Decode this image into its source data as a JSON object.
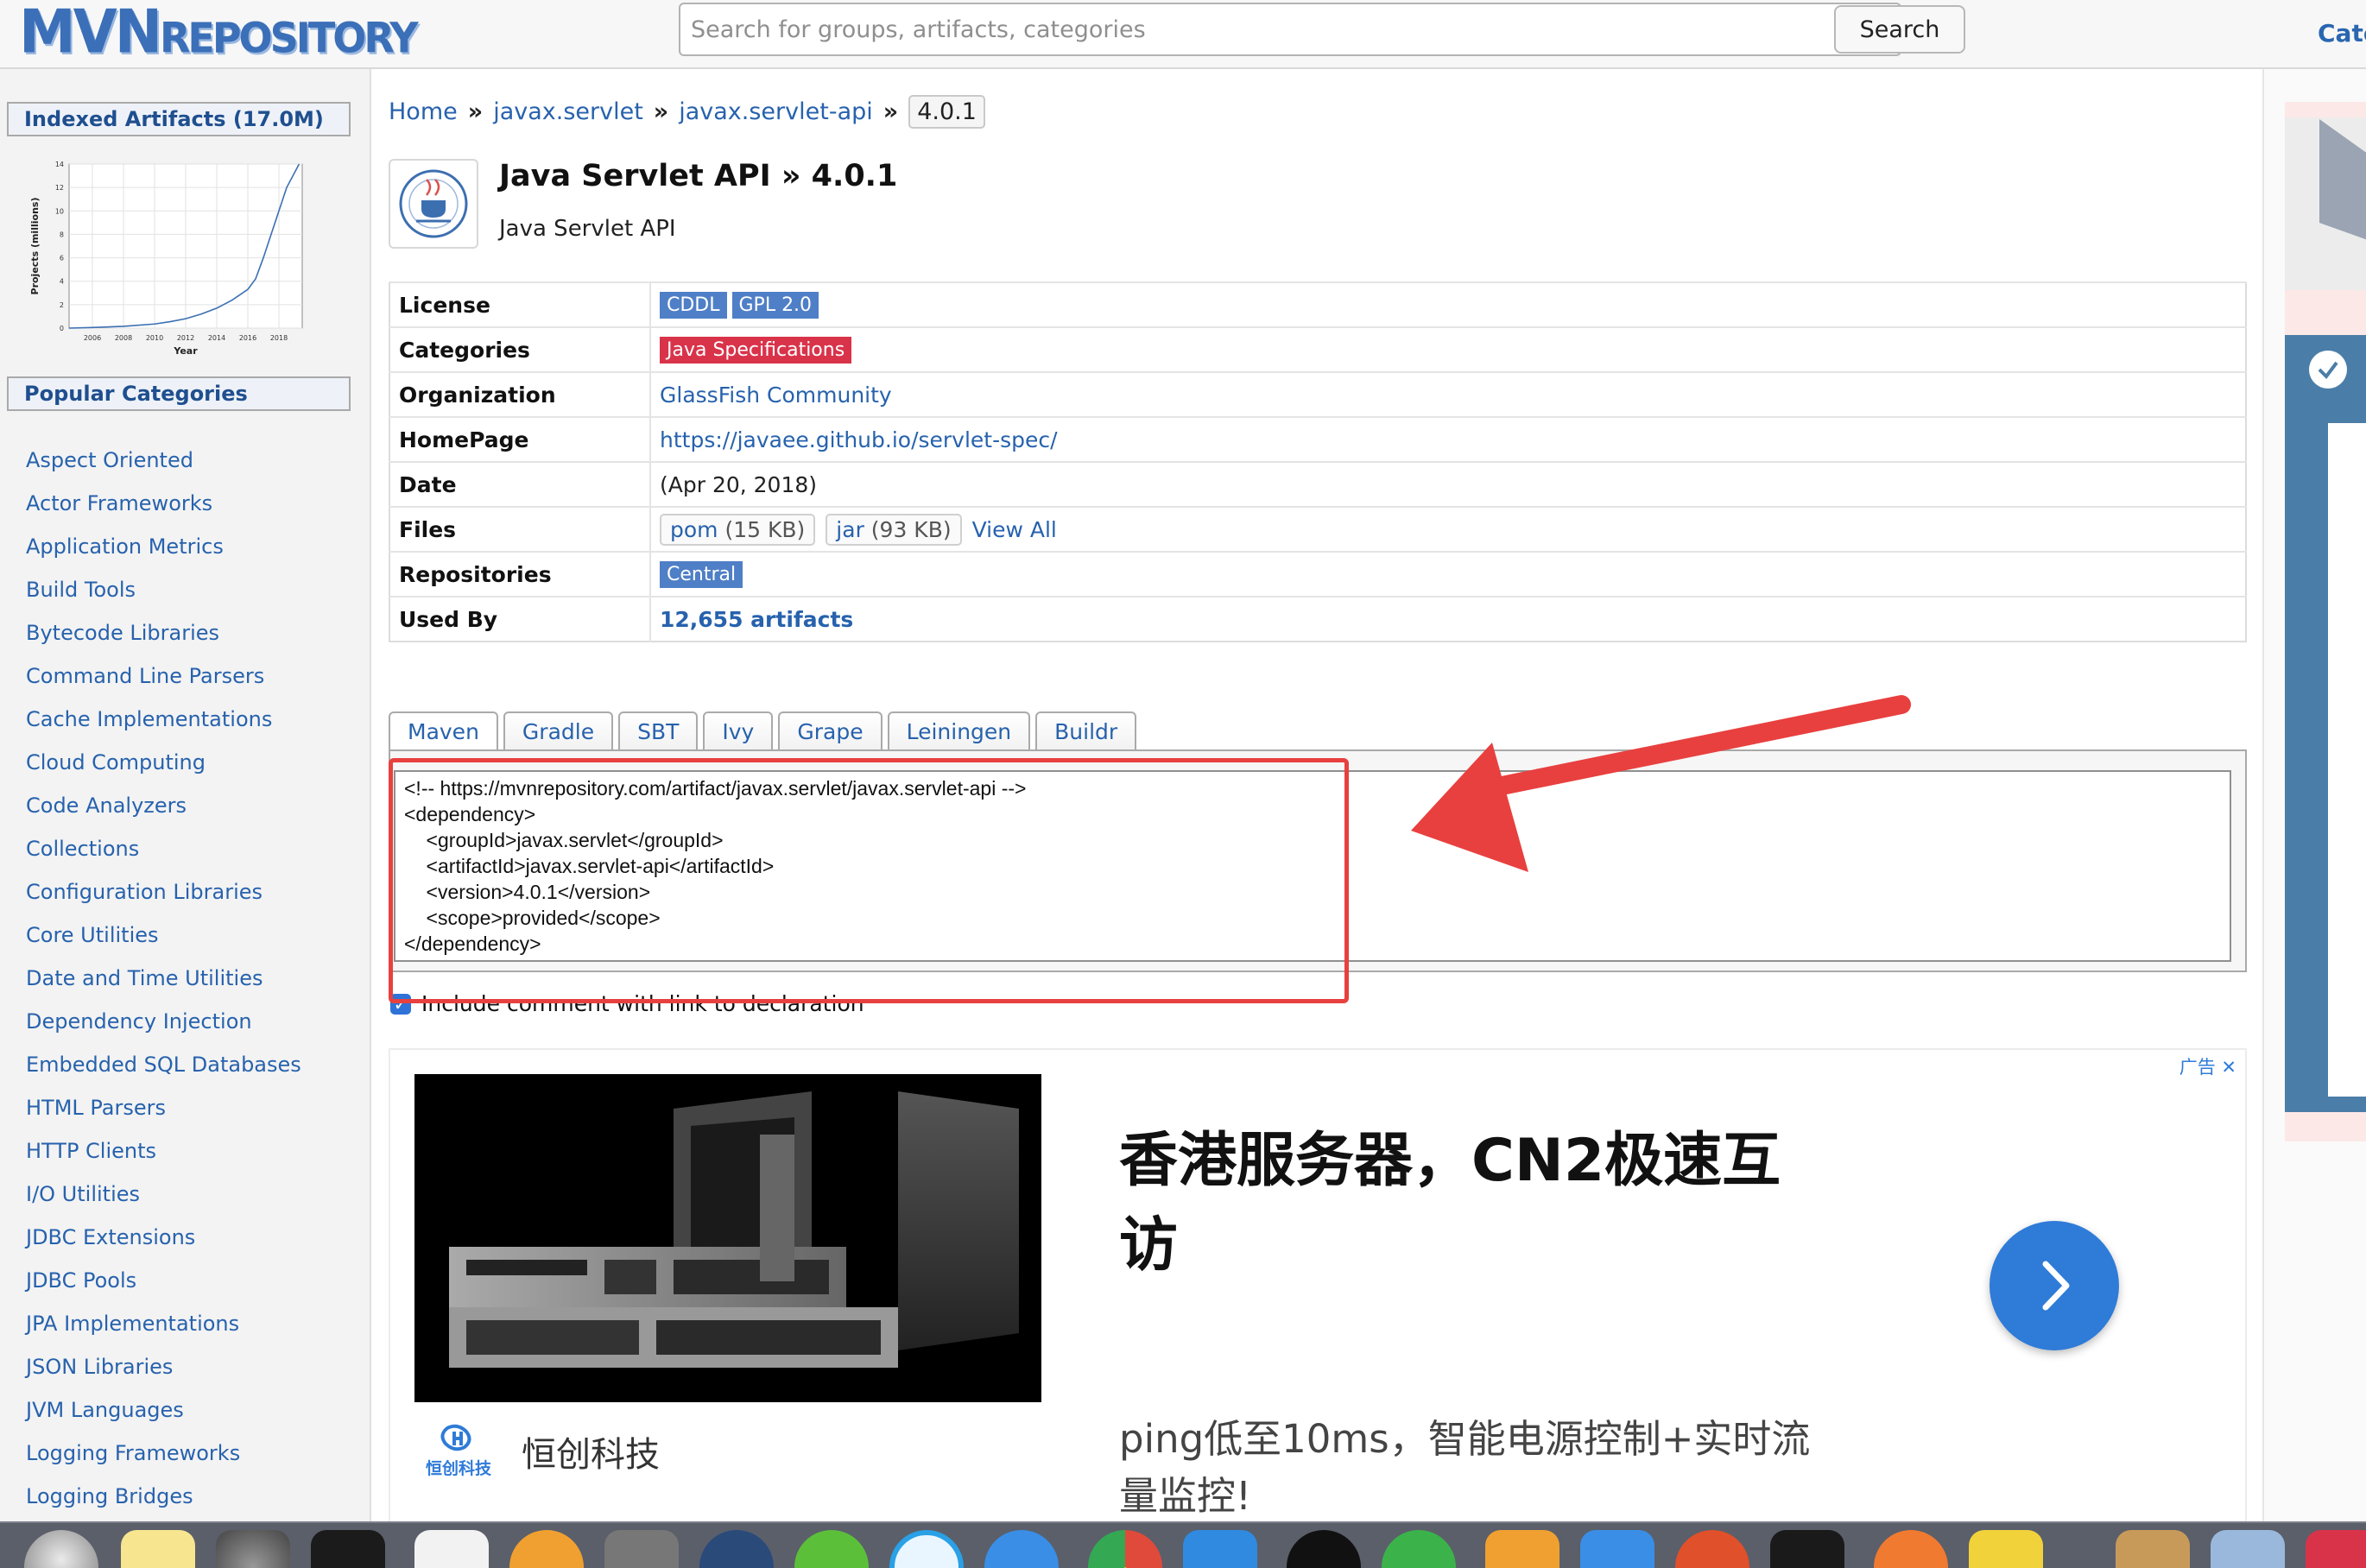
{
  "header": {
    "logo_big": "MVN",
    "logo_small": "REPOSITORY",
    "search_placeholder": "Search for groups, artifacts, categories",
    "search_button": "Search",
    "categories_link": "Cate"
  },
  "sidebar": {
    "indexed_heading": "Indexed Artifacts (17.0M)",
    "chart_heading": "Popular Categories",
    "categories": [
      "Aspect Oriented",
      "Actor Frameworks",
      "Application Metrics",
      "Build Tools",
      "Bytecode Libraries",
      "Command Line Parsers",
      "Cache Implementations",
      "Cloud Computing",
      "Code Analyzers",
      "Collections",
      "Configuration Libraries",
      "Core Utilities",
      "Date and Time Utilities",
      "Dependency Injection",
      "Embedded SQL Databases",
      "HTML Parsers",
      "HTTP Clients",
      "I/O Utilities",
      "JDBC Extensions",
      "JDBC Pools",
      "JPA Implementations",
      "JSON Libraries",
      "JVM Languages",
      "Logging Frameworks",
      "Logging Bridges"
    ]
  },
  "chart_data": {
    "type": "line",
    "title": "",
    "xlabel": "Year",
    "ylabel": "Projects (millions)",
    "x_ticks": [
      "2006",
      "2008",
      "2010",
      "2012",
      "2014",
      "2016",
      "2018"
    ],
    "y_ticks": [
      "0",
      "2",
      "4",
      "6",
      "8",
      "10",
      "12",
      "14"
    ],
    "xlim": [
      2004.5,
      2019.5
    ],
    "ylim": [
      0,
      14
    ],
    "grid": true,
    "x": [
      2004.5,
      2006,
      2008,
      2010,
      2011,
      2012,
      2013,
      2014,
      2015,
      2016,
      2016.5,
      2017,
      2017.5,
      2018,
      2018.5,
      2019.3
    ],
    "y": [
      0.0,
      0.05,
      0.15,
      0.35,
      0.55,
      0.8,
      1.2,
      1.7,
      2.4,
      3.3,
      4.2,
      6.0,
      8.0,
      10.0,
      12.0,
      14.0
    ]
  },
  "breadcrumb": {
    "home": "Home",
    "group": "javax.servlet",
    "artifact": "javax.servlet-api",
    "version": "4.0.1",
    "separator": "»"
  },
  "artifact": {
    "title": "Java Servlet API » 4.0.1",
    "subtitle": "Java Servlet API"
  },
  "info": {
    "license_label": "License",
    "licenses": [
      "CDDL",
      "GPL 2.0"
    ],
    "categories_label": "Categories",
    "category": "Java Specifications",
    "organization_label": "Organization",
    "organization": "GlassFish Community",
    "homepage_label": "HomePage",
    "homepage": "https://javaee.github.io/servlet-spec/",
    "date_label": "Date",
    "date": "(Apr 20, 2018)",
    "files_label": "Files",
    "file_pom": "pom",
    "file_pom_size": "(15 KB)",
    "file_jar": "jar",
    "file_jar_size": "(93 KB)",
    "view_all": "View All",
    "repositories_label": "Repositories",
    "repository": "Central",
    "used_by_label": "Used By",
    "used_by": "12,655 artifacts"
  },
  "tabs": [
    "Maven",
    "Gradle",
    "SBT",
    "Ivy",
    "Grape",
    "Leiningen",
    "Buildr"
  ],
  "snippet": "<!-- https://mvnrepository.com/artifact/javax.servlet/javax.servlet-api -->\n<dependency>\n    <groupId>javax.servlet</groupId>\n    <artifactId>javax.servlet-api</artifactId>\n    <version>4.0.1</version>\n    <scope>provided</scope>\n</dependency>",
  "include_comment": "Include comment with link to declaration",
  "ad": {
    "label": "广告",
    "close": "✕",
    "headline": "香港服务器，CN2极速互访",
    "description": "ping低至10ms，智能电源控制+实时流量监控!",
    "brand_logo_text": "恒创科技",
    "brand_name": "恒创科技"
  },
  "colors": {
    "link": "#2762ad",
    "tag_blue": "#4f7fc6",
    "tag_red": "#d9334a",
    "highlight_red": "#e8403f",
    "ad_button": "#2f7bd8"
  }
}
